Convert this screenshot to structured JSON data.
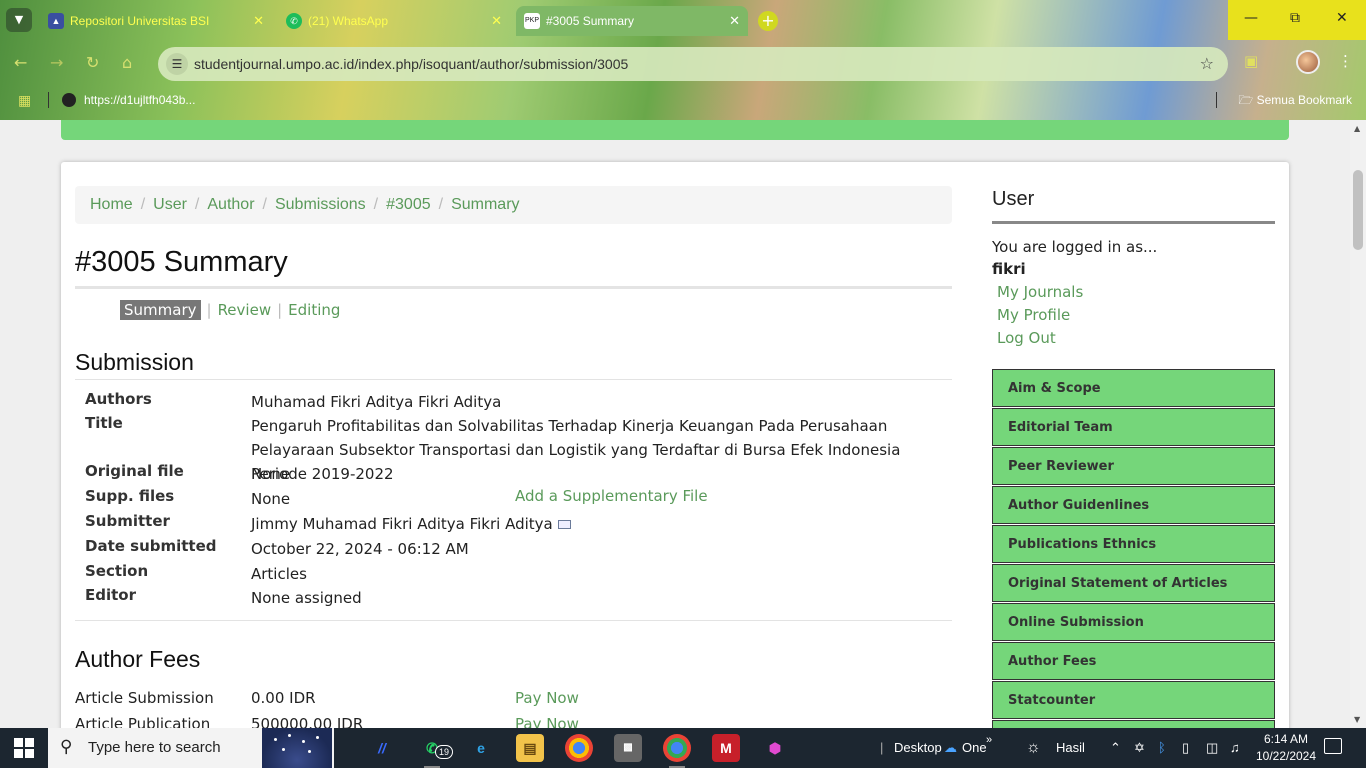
{
  "browser": {
    "tabs": [
      {
        "title": "Repositori Universitas BSI",
        "favicon": "bsi-shield-icon",
        "active": false
      },
      {
        "title": "(21) WhatsApp",
        "favicon": "whatsapp-icon",
        "active": false
      },
      {
        "title": "#3005 Summary",
        "favicon": "pkp-icon",
        "favicon_text": "PKP",
        "active": true
      }
    ],
    "new_tab_label": "+",
    "url": "studentjournal.umpo.ac.id/index.php/isoquant/author/submission/3005",
    "bookmark_item": "https://d1ujltfh043b...",
    "all_bookmarks": "Semua Bookmark"
  },
  "page": {
    "breadcrumbs": [
      "Home",
      "User",
      "Author",
      "Submissions",
      "#3005",
      "Summary"
    ],
    "title": "#3005 Summary",
    "subtabs": {
      "current": "Summary",
      "others": [
        "Review",
        "Editing"
      ]
    },
    "submission": {
      "heading": "Submission",
      "rows": [
        {
          "label": "Authors",
          "value": "Muhamad Fikri Aditya Fikri Aditya"
        },
        {
          "label": "Title",
          "value": "Pengaruh Profitabilitas dan Solvabilitas Terhadap Kinerja Keuangan Pada Perusahaan Pelayaraan Subsektor Transportasi dan Logistik yang Terdaftar di Bursa Efek Indonesia Periode 2019-2022"
        },
        {
          "label": "Original file",
          "value": "None"
        },
        {
          "label": "Supp. files",
          "value": "None",
          "action": "Add a Supplementary File"
        },
        {
          "label": "Submitter",
          "value": "Jimmy Muhamad Fikri Aditya Fikri Aditya"
        },
        {
          "label": "Date submitted",
          "value": "October 22, 2024 - 06:12 AM"
        },
        {
          "label": "Section",
          "value": "Articles"
        },
        {
          "label": "Editor",
          "value": "None assigned"
        }
      ]
    },
    "author_fees": {
      "heading": "Author Fees",
      "rows": [
        {
          "label": "Article Submission",
          "value": "0.00 IDR",
          "action": "Pay Now"
        },
        {
          "label": "Article Publication",
          "value": "500000.00 IDR",
          "action": "Pay Now"
        }
      ]
    }
  },
  "sidebar": {
    "heading": "User",
    "logged_in_as": "You are logged in as...",
    "username": "fikri",
    "links": [
      "My Journals",
      "My Profile",
      "Log Out"
    ],
    "menu": [
      "Aim & Scope",
      "Editorial Team",
      "Peer Reviewer",
      "Author Guidenlines",
      "Publications Ethnics",
      "Original Statement of Articles",
      "Online Submission",
      "Author Fees",
      "Statcounter"
    ]
  },
  "taskbar": {
    "search_placeholder": "Type here to search",
    "whatsapp_badge": "19",
    "desktop_label": "Desktop",
    "onedrive_label": "One",
    "weather": "Hasil",
    "time": "6:14 AM",
    "date": "10/22/2024"
  },
  "colors": {
    "accent_green": "#75d67a",
    "link_green": "#5a9a5a",
    "taskbar": "#1c2630"
  }
}
